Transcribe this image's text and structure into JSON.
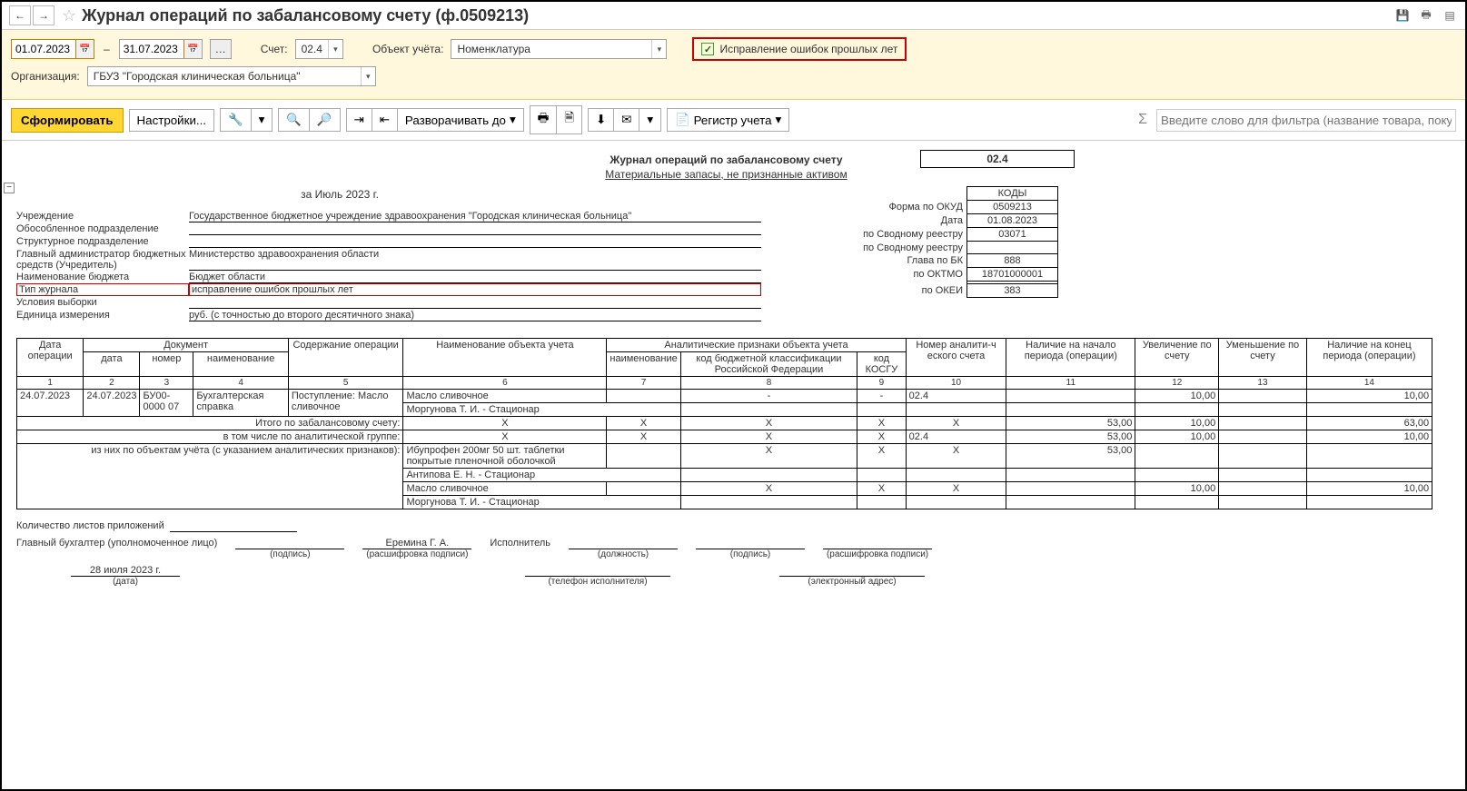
{
  "title": "Журнал операций по забалансовому счету (ф.0509213)",
  "filters": {
    "date_from": "01.07.2023",
    "date_to": "31.07.2023",
    "account_lbl": "Счет:",
    "account": "02.4",
    "object_lbl": "Объект учёта:",
    "object": "Номенклатура",
    "chk_label": "Исправление ошибок прошлых лет",
    "org_lbl": "Организация:",
    "org": "ГБУЗ \"Городская клиническая больница\""
  },
  "toolbar": {
    "form": "Сформировать",
    "settings": "Настройки...",
    "expand": "Разворачивать до",
    "registry": "Регистр учета",
    "filter_ph": "Введите слово для фильтра (название товара, покупателя и пр.)"
  },
  "report": {
    "title": "Журнал операций по забалансовому счету",
    "subtitle": "Материальные запасы, не признанные активом",
    "account_code": "02.4",
    "period": "за Июль 2023 г.",
    "codes_hdr": "КОДЫ",
    "okud_lbl": "Форма по ОКУД",
    "okud": "0509213",
    "date_lbl": "Дата",
    "date": "01.08.2023",
    "reg1_lbl": "по Сводному реестру",
    "reg1": "03071",
    "reg2_lbl": "по Сводному реестру",
    "reg2": "",
    "glava_lbl": "Глава по БК",
    "glava": "888",
    "oktmo_lbl": "по ОКТМО",
    "oktmo": "18701000001",
    "okei_lbl": "по ОКЕИ",
    "okei": "383",
    "r_inst_lbl": "Учреждение",
    "r_inst": "Государственное бюджетное учреждение здравоохранения \"Городская клиническая больница\"",
    "r_sep_lbl": "Обособленное подразделение",
    "r_sep": "",
    "r_struct_lbl": "Структурное подразделение",
    "r_struct": "",
    "r_admin_lbl": "Главный администратор бюджетных средств (Учредитель)",
    "r_admin": "Министерство здравоохранения области",
    "r_budget_lbl": "Наименование бюджета",
    "r_budget": "Бюджет области",
    "r_type_lbl": "Тип журнала",
    "r_type": "исправление ошибок прошлых лет",
    "r_cond_lbl": "Условия выборки",
    "r_cond": "",
    "r_unit_lbl": "Единица измерения",
    "r_unit": "руб. (с точностью до второго десятичного знака)"
  },
  "grid_hdr": {
    "c1": "Дата операции",
    "c2": "Документ",
    "c2a": "дата",
    "c2b": "номер",
    "c2c": "наименование",
    "c3": "Содержание операции",
    "c4": "Наименование объекта учета",
    "c5": "Аналитические признаки объекта учета",
    "c5a": "наименование",
    "c5b": "код бюджетной классификации Российской Федерации",
    "c5c": "код КОСГУ",
    "c6": "Номер аналити-ч еского счета",
    "c7": "Наличие на начало периода (операции)",
    "c8": "Увеличение по счету",
    "c9": "Уменьшение по счету",
    "c10": "Наличие на конец периода (операции)"
  },
  "grid_num": {
    "n1": "1",
    "n2": "2",
    "n3": "3",
    "n4": "4",
    "n5": "5",
    "n6": "6",
    "n7": "7",
    "n8": "8",
    "n9": "9",
    "n10": "10",
    "n11": "11",
    "n12": "12",
    "n13": "13",
    "n14": "14"
  },
  "row1": {
    "op_date": "24.07.2023",
    "doc_date": "24.07.2023",
    "num": "БУ00-0000 07",
    "name": "Бухгалтерская справка",
    "content": "Поступление: Масло сливочное",
    "obj": "Масло сливочное",
    "anal": "Моргунова Т. И. - Стационар",
    "kbk": "-",
    "kosgu": "-",
    "acct": "02.4",
    "start": "",
    "inc": "10,00",
    "dec": "",
    "end": "10,00"
  },
  "sum": {
    "l1": "Итого по забалансовому счету:",
    "v1_start": "53,00",
    "v1_inc": "10,00",
    "v1_end": "63,00",
    "l2": "в том числе по аналитической группе:",
    "v2_acct": "02.4",
    "v2_start": "53,00",
    "v2_inc": "10,00",
    "v2_end": "10,00",
    "l3": "из них по объектам учёта (с указанием аналитических признаков):",
    "d1_obj": "Ибупрофен 200мг 50 шт. таблетки покрытые пленочной оболочкой",
    "d1_anal": "Антипова Е. Н. - Стационар",
    "d1_start": "53,00",
    "d2_obj": "Масло сливочное",
    "d2_anal": "Моргунова Т. И. - Стационар",
    "d2_inc": "10,00",
    "d2_end": "10,00"
  },
  "footer": {
    "sheets": "Количество листов приложений",
    "glav": "Главный бухгалтер (уполномоченное лицо)",
    "sign": "(подпись)",
    "fio": "Еремина Г. А.",
    "rasssh": "(расшифровка подписи)",
    "isp": "Исполнитель",
    "dolj": "(должность)",
    "tel": "(телефон исполнителя)",
    "email": "(электронный адрес)",
    "date_val": "28 июля 2023 г.",
    "date_lbl": "(дата)"
  }
}
